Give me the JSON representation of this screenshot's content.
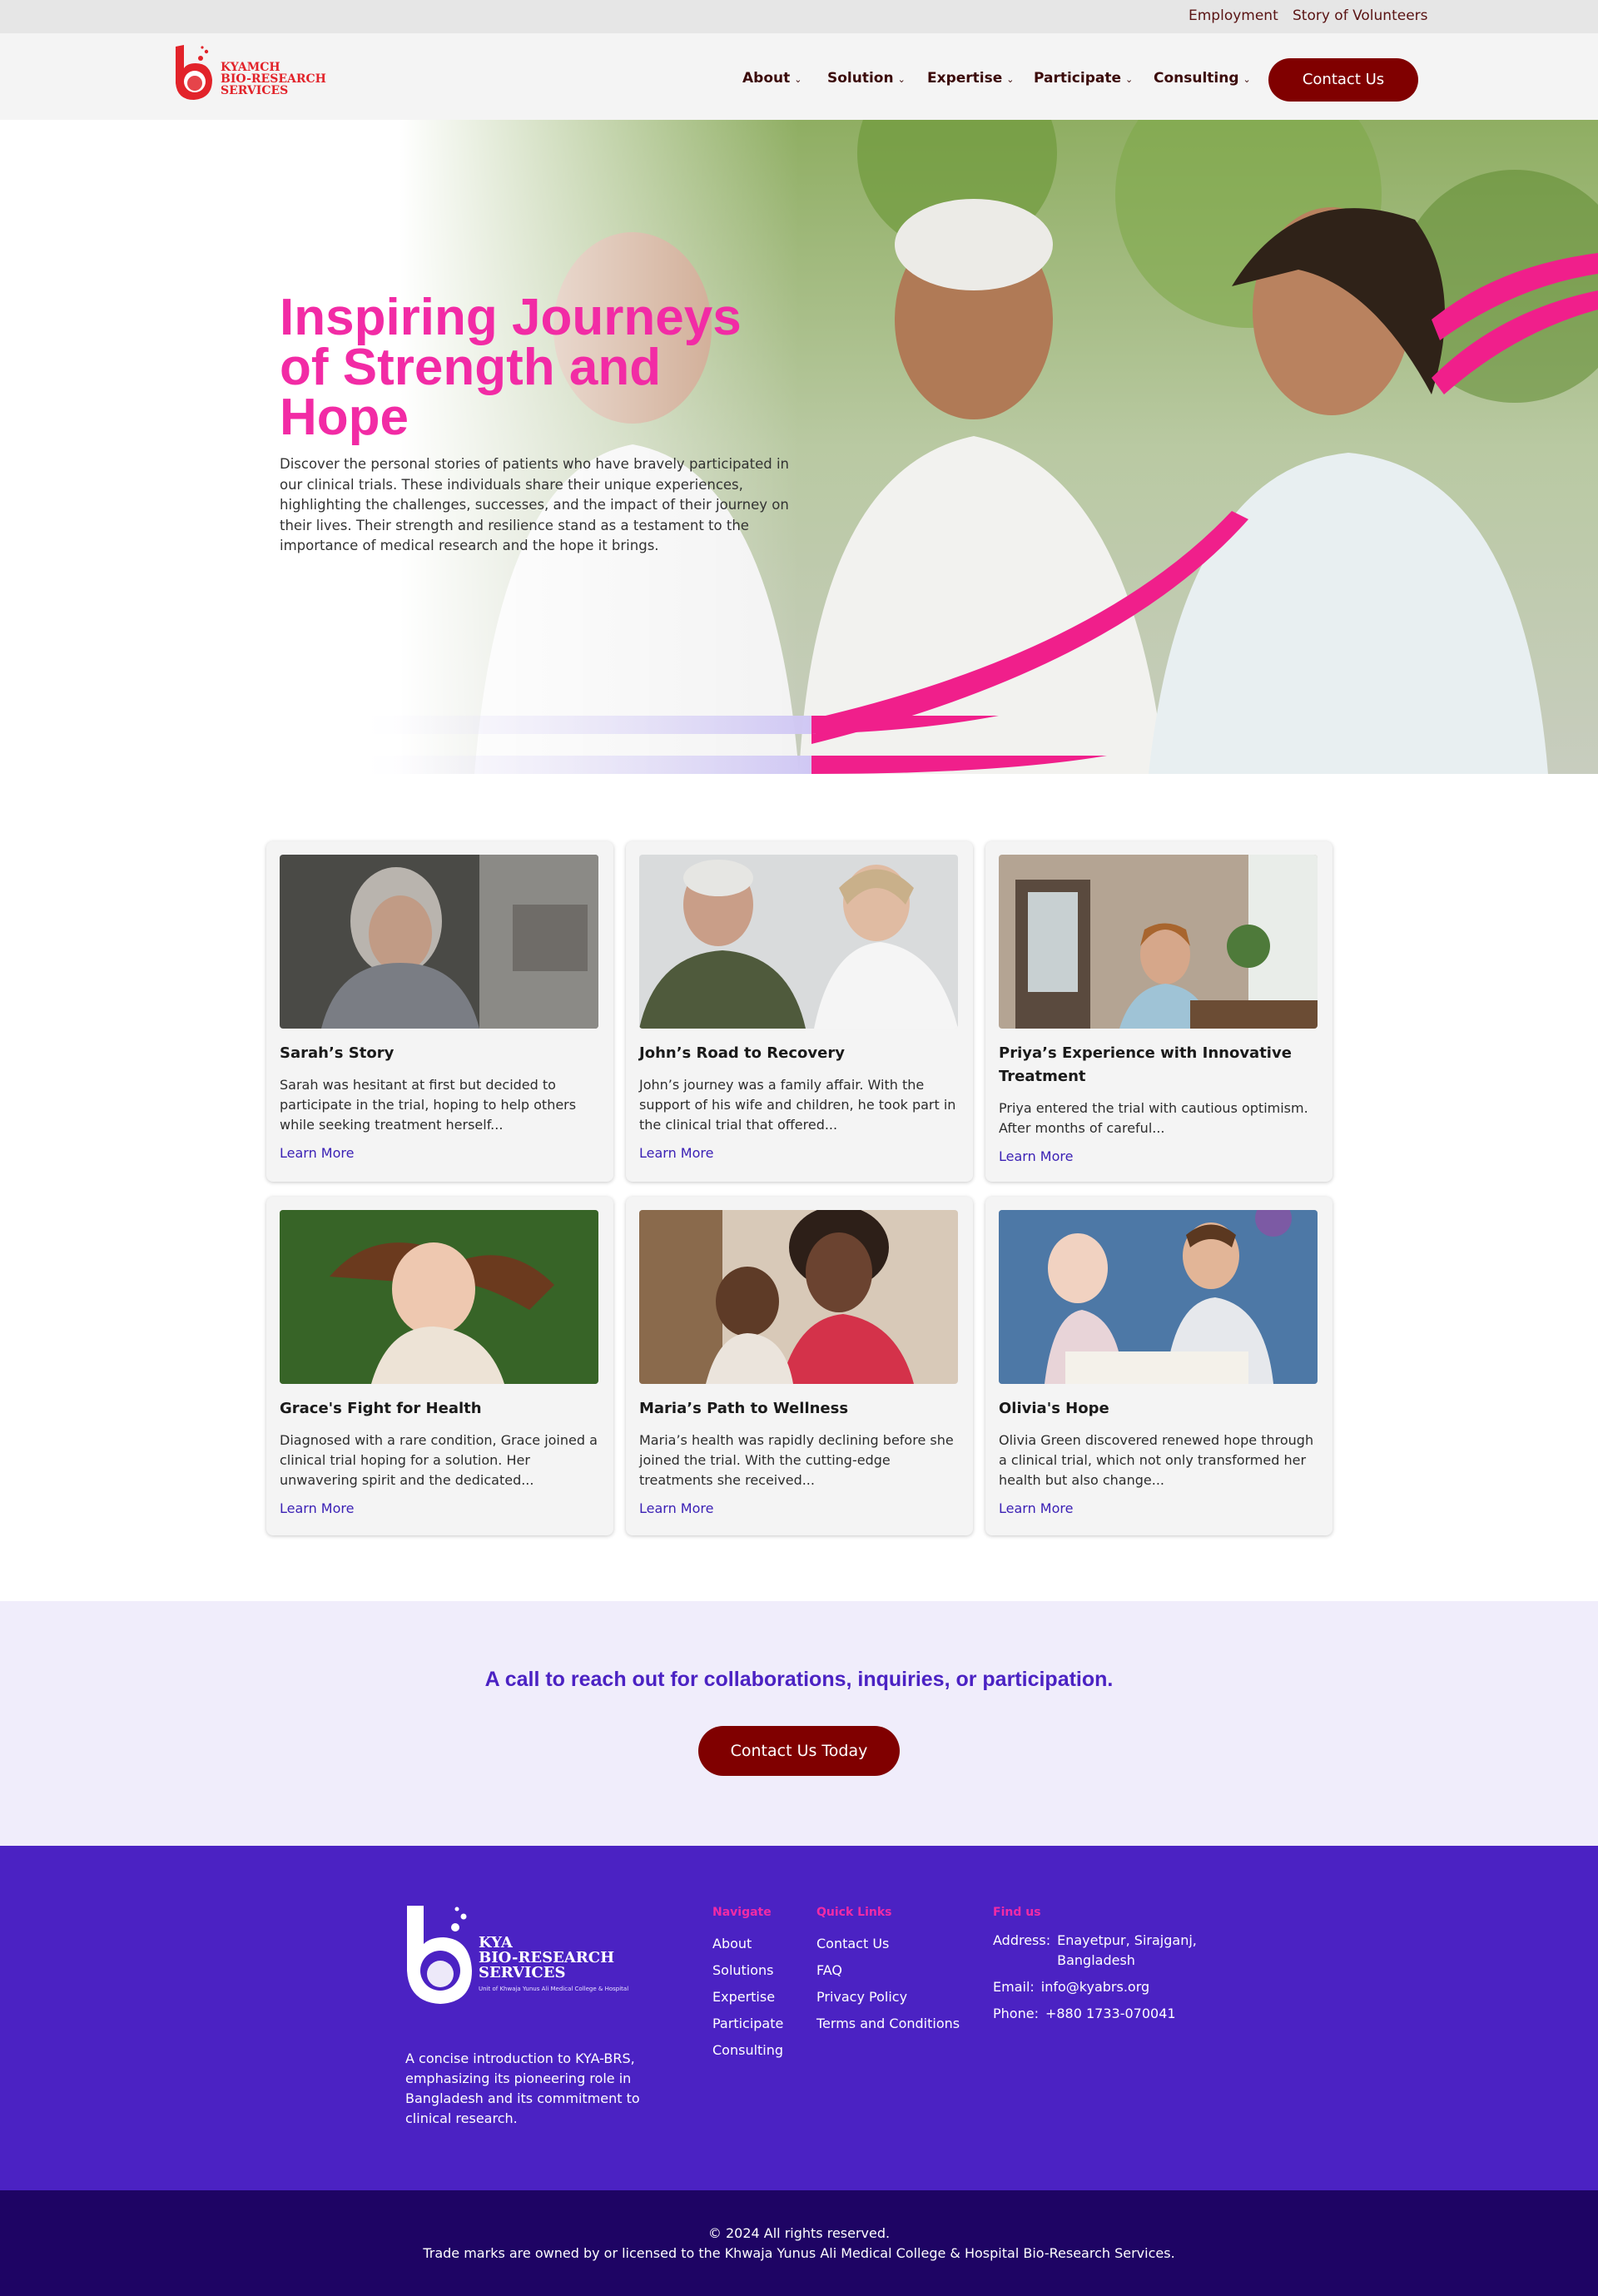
{
  "topbar": {
    "links": [
      "Employment",
      "Story of Volunteers"
    ]
  },
  "brand": {
    "logo_lines": [
      "KYAMCH",
      "BIO-RESEARCH",
      "SERVICES"
    ],
    "accent": "#e2232a"
  },
  "nav": {
    "items": [
      "About",
      "Solution",
      "Expertise",
      "Participate",
      "Consulting"
    ],
    "contact_label": "Contact Us"
  },
  "hero": {
    "title": "Inspiring Journeys of Strength and Hope",
    "description": "Discover the personal stories of patients who have bravely participated in our clinical trials. These individuals share their unique experiences, highlighting the challenges, successes, and the impact of their journey on their lives. Their strength and resilience stand as a testament to the importance of medical research and the hope it brings."
  },
  "stories": [
    {
      "title": "Sarah’s Story",
      "excerpt": "Sarah was hesitant at first but decided to participate in the trial, hoping to help others while seeking treatment herself...",
      "link": "Learn More"
    },
    {
      "title": "John’s Road to Recovery",
      "excerpt": "John’s journey was a family affair. With the support of his wife and children, he took part in the clinical trial that offered...",
      "link": "Learn More"
    },
    {
      "title": "Priya’s Experience with Innovative Treatment",
      "excerpt": "Priya entered the trial with cautious optimism. After months of careful...",
      "link": "Learn More"
    },
    {
      "title": "Grace's Fight for Health",
      "excerpt": "Diagnosed with a rare condition, Grace joined a clinical trial hoping for a solution. Her unwavering spirit and the dedicated...",
      "link": "Learn More"
    },
    {
      "title": "Maria’s Path to Wellness",
      "excerpt": "Maria’s health was rapidly declining before she joined the trial. With the cutting-edge treatments she received...",
      "link": "Learn More"
    },
    {
      "title": "Olivia's Hope",
      "excerpt": "Olivia Green discovered renewed hope through a clinical trial, which not only transformed her health but also change...",
      "link": "Learn More"
    }
  ],
  "cta": {
    "text": "A call to reach out for collaborations, inquiries, or participation.",
    "button": "Contact Us Today"
  },
  "footer": {
    "logo_lines": [
      "KYA",
      "BIO-RESEARCH",
      "SERVICES"
    ],
    "logo_sub": "Unit of Khwaja Yunus Ali Medical College & Hospital",
    "intro": "A concise introduction to KYA-BRS, emphasizing its pioneering role in Bangladesh and its commitment to clinical research.",
    "navigate": {
      "heading": "Navigate",
      "links": [
        "About",
        "Solutions",
        "Expertise",
        "Participate",
        "Consulting"
      ]
    },
    "quick": {
      "heading": "Quick Links",
      "links": [
        "Contact Us",
        "FAQ",
        "Privacy Policy",
        "Terms and Conditions"
      ]
    },
    "find": {
      "heading": "Find us",
      "address_label": "Address:",
      "address": "Enayetpur, Sirajganj, Bangladesh",
      "email_label": "Email:",
      "email": "info@kyabrs.org",
      "phone_label": "Phone:",
      "phone": "+880 1733-070041"
    },
    "copyright": "© 2024 All rights reserved.",
    "trademark": "Trade marks are owned by or licensed to the Khwaja Yunus Ali Medical College & Hospital Bio-Research Services."
  },
  "colors": {
    "primary": "#4b22c3",
    "button": "#800000",
    "hero_title": "#f22ba5",
    "dark_footer": "#1e0464"
  }
}
